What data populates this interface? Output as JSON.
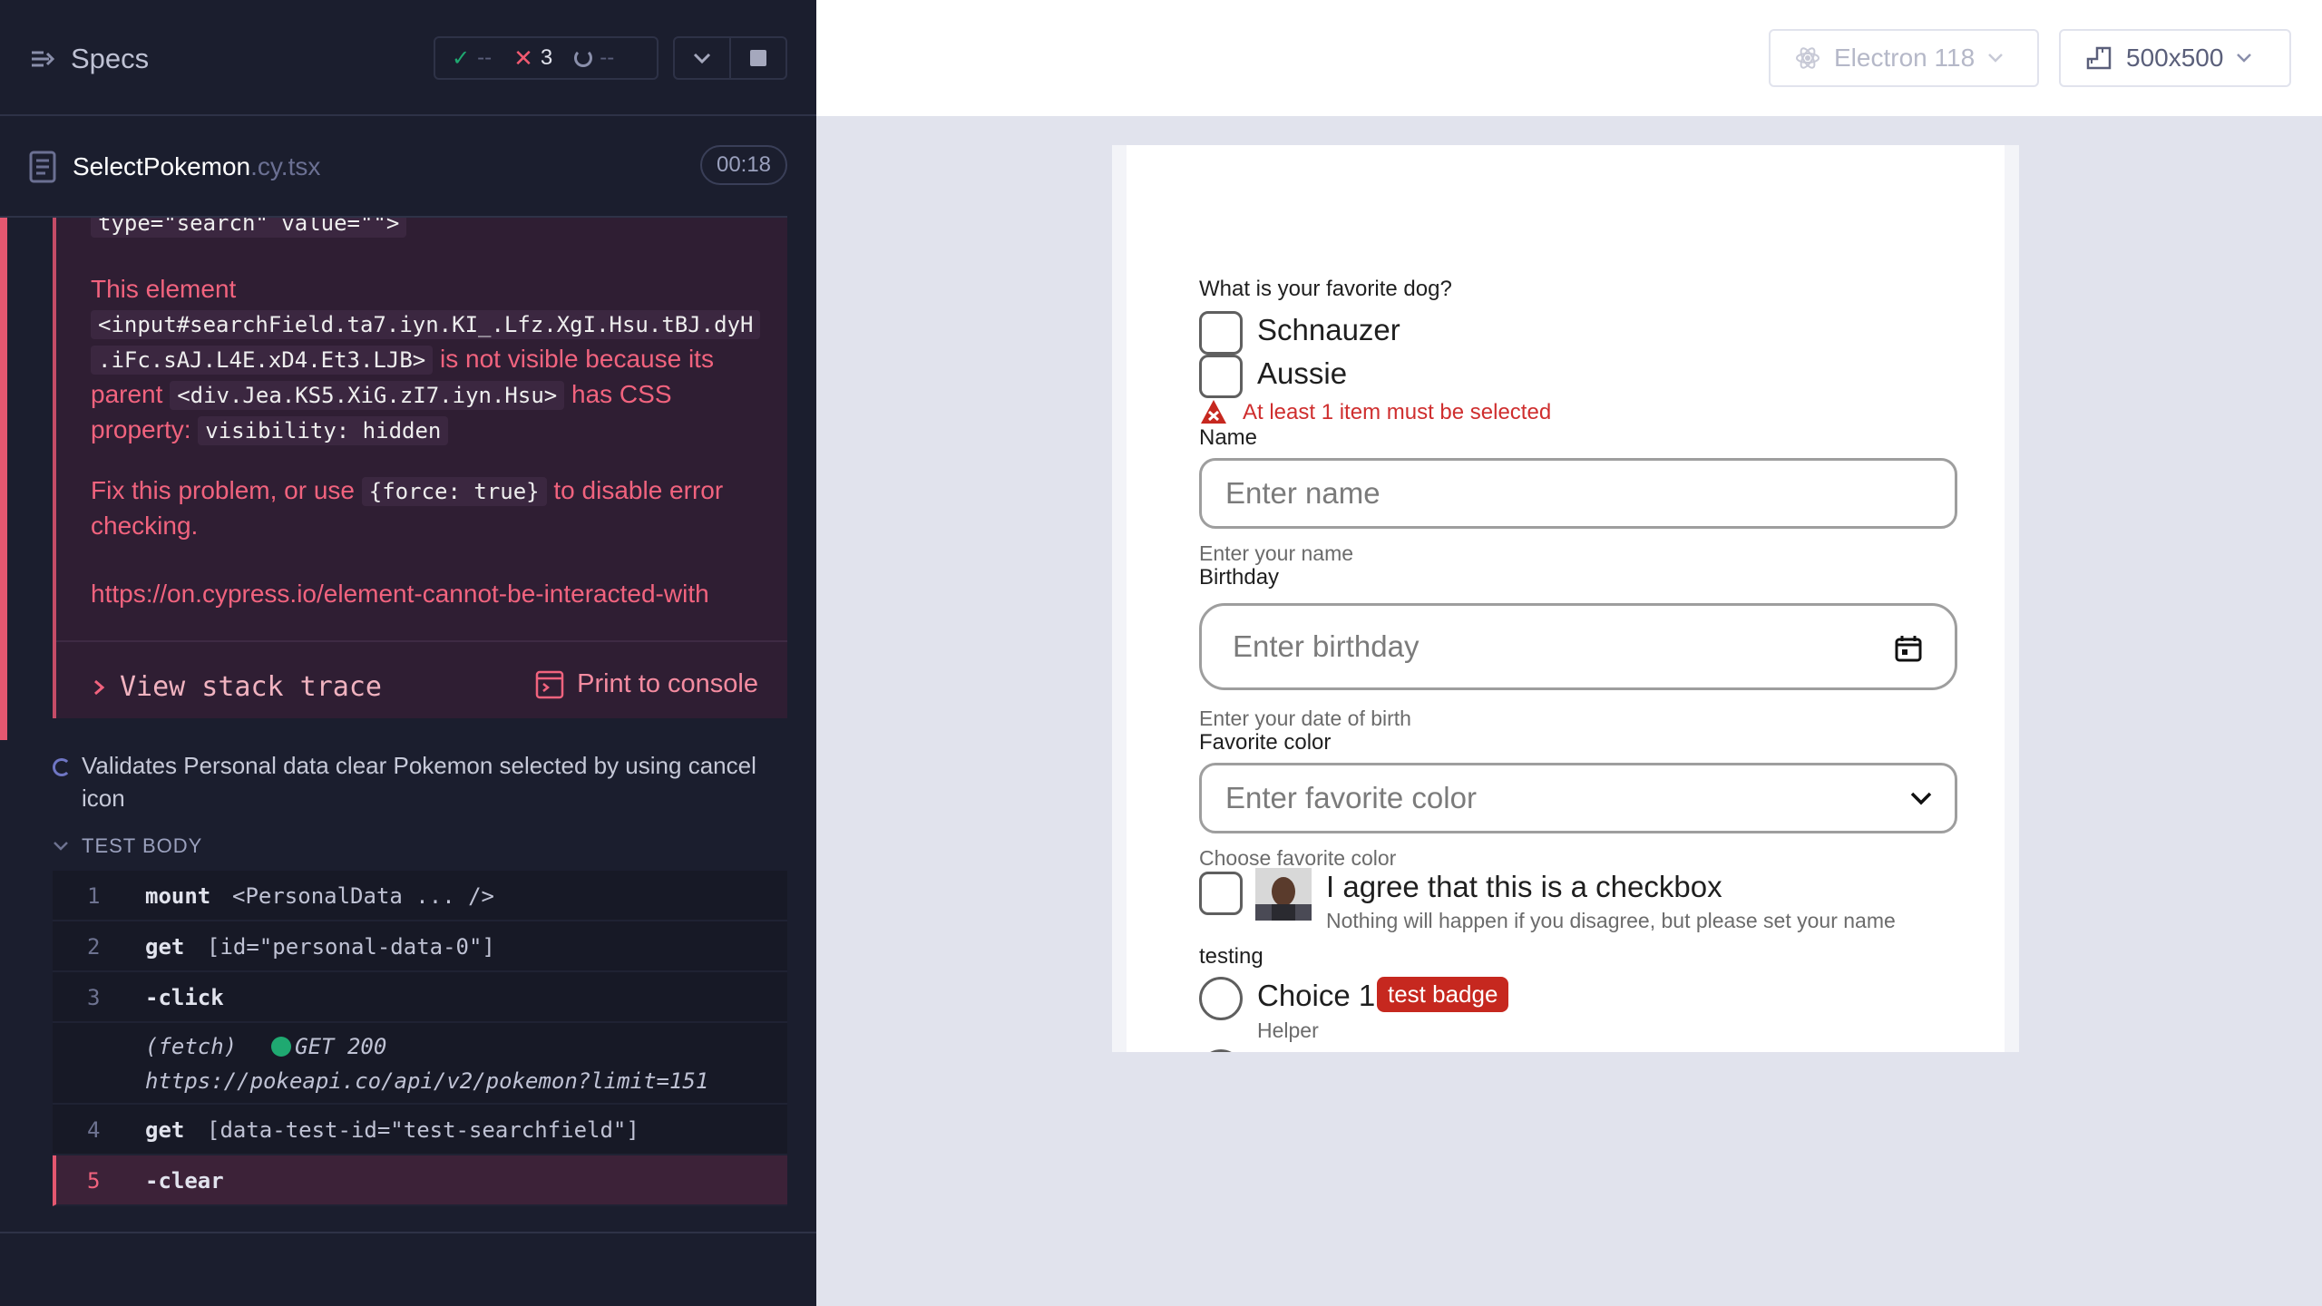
{
  "reporter": {
    "title": "Specs",
    "stats": {
      "passed": "--",
      "failed": "3",
      "pending": "--"
    },
    "file": {
      "name": "SelectPokemon",
      "ext": ".cy.tsx",
      "duration": "00:18"
    },
    "error": {
      "code_top": "type=\"search\" value=\"\">",
      "para1_prefix": "This element",
      "para1_element": "<input#searchField.ta7.iyn.KI_.Lfz.XgI.Hsu.tBJ.dyH",
      "para1_element2": ".iFc.sAJ.L4E.xD4.Et3.LJB>",
      "para1_mid": "is not visible because its",
      "para1_parent_word": "parent",
      "para1_parent": "<div.Jea.KS5.XiG.zI7.iyn.Hsu>",
      "para1_css": "has CSS",
      "para1_property": "property:",
      "para1_visibility": "visibility: hidden",
      "para2_prefix": "Fix this problem, or use",
      "para2_code": "{force: true}",
      "para2_suffix": "to disable error",
      "para2_end": "checking.",
      "link": "https://on.cypress.io/element-cannot-be-interacted-with",
      "stack_trace": "View stack trace",
      "print_console": "Print to console"
    },
    "test_title": "Validates Personal data clear Pokemon selected by using cancel icon",
    "test_body_label": "TEST BODY",
    "commands": [
      {
        "num": "1",
        "name": "mount",
        "msg": "<PersonalData ... />"
      },
      {
        "num": "2",
        "name": "get",
        "msg": "[id=\"personal-data-0\"]"
      },
      {
        "num": "3",
        "name": "-click",
        "msg": ""
      },
      {
        "num": "",
        "name": "(fetch)",
        "status": "GET 200",
        "url": "https://pokeapi.co/api/v2/pokemon?limit=151"
      },
      {
        "num": "4",
        "name": "get",
        "msg": "[data-test-id=\"test-searchfield\"]"
      },
      {
        "num": "5",
        "name": "-clear",
        "msg": ""
      }
    ]
  },
  "aut_header": {
    "browser": "Electron 118",
    "viewport": "500x500"
  },
  "form": {
    "dog_question": "What is your favorite dog?",
    "dog_options": [
      "Schnauzer",
      "Aussie"
    ],
    "dog_error": "At least 1 item must be selected",
    "name_label": "Name",
    "name_placeholder": "Enter name",
    "name_helper": "Enter your name",
    "birthday_label": "Birthday",
    "birthday_placeholder": "Enter birthday",
    "birthday_helper": "Enter your date of birth",
    "color_label": "Favorite color",
    "color_placeholder": "Enter favorite color",
    "color_helper": "Choose favorite color",
    "agree_label": "I agree that this is a checkbox",
    "agree_helper": "Nothing will happen if you disagree, but please set your name",
    "radio_group_label": "testing",
    "choice1_label": "Choice 1",
    "choice1_badge": "test badge",
    "choice1_helper": "Helper"
  },
  "colors": {
    "fail": "#f1637e",
    "pass": "#1fa971",
    "panel_bg": "#1b1e2e",
    "error_red": "#cf2e2e",
    "badge_red": "#c6281f"
  }
}
